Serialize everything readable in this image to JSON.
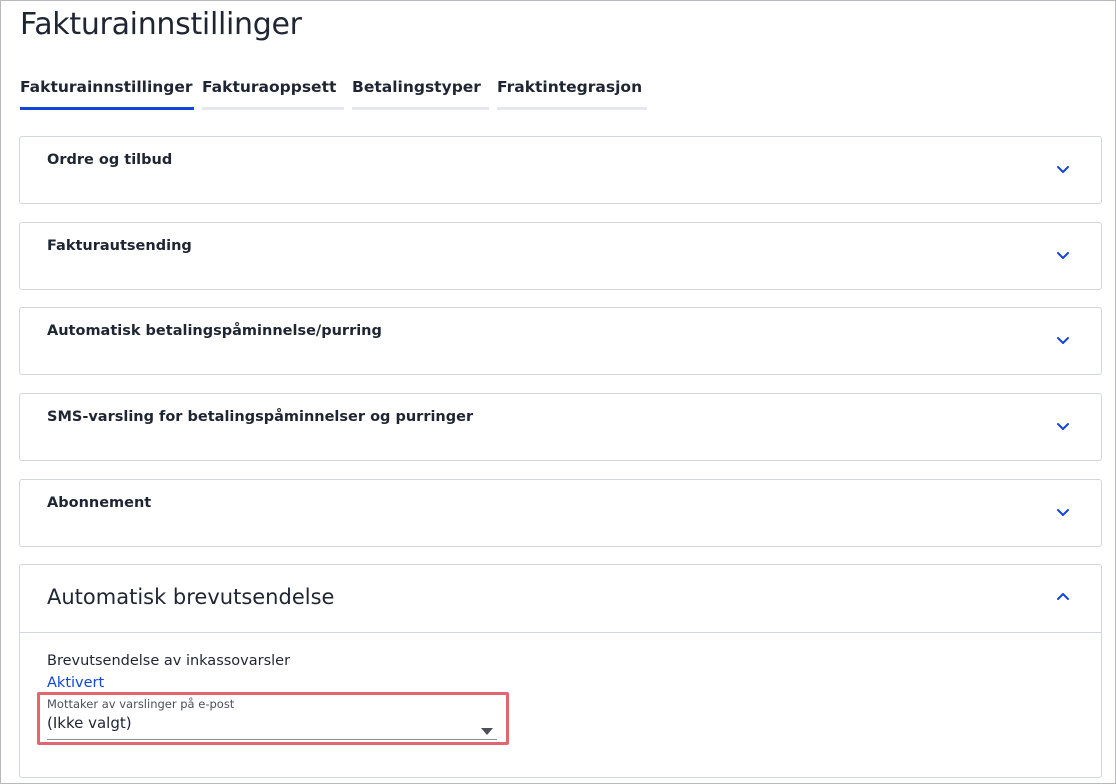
{
  "page": {
    "title": "Fakturainnstillinger"
  },
  "tabs": [
    {
      "label": "Fakturainnstillinger",
      "active": true
    },
    {
      "label": "Fakturaoppsett",
      "active": false
    },
    {
      "label": "Betalingstyper",
      "active": false
    },
    {
      "label": "Fraktintegrasjon",
      "active": false
    }
  ],
  "sections": [
    {
      "title": "Ordre og tilbud",
      "expanded": false
    },
    {
      "title": "Fakturautsending",
      "expanded": false
    },
    {
      "title": "Automatisk betalingspåminnelse/purring",
      "expanded": false
    },
    {
      "title": "SMS-varsling for betalingspåminnelser og purringer",
      "expanded": false
    },
    {
      "title": "Abonnement",
      "expanded": false
    },
    {
      "title": "Automatisk brevutsendelse",
      "expanded": true,
      "body": {
        "label": "Brevutsendelse av inkassovarsler",
        "status_link": "Aktivert",
        "select": {
          "label": "Mottaker av varslinger på e-post",
          "value": "(Ikke valgt)"
        }
      }
    }
  ],
  "colors": {
    "accent": "#1346d6",
    "highlight_border": "#e06672",
    "text": "#1f2532",
    "panel_border": "#d3d6dc"
  },
  "icons": {
    "collapsed": "chevron-down-icon",
    "expanded": "chevron-up-icon",
    "select": "caret-down-icon"
  }
}
